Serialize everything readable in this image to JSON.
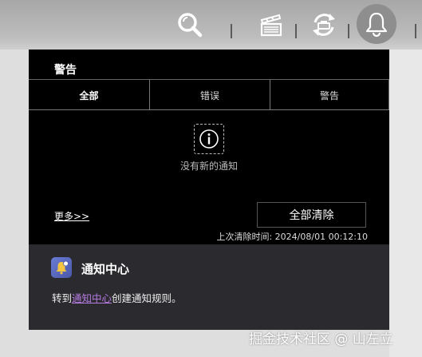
{
  "toolbar": {
    "icons": [
      "search-icon",
      "clapperboard-icon",
      "sync-icon",
      "bell-icon"
    ]
  },
  "popup": {
    "title": "警告",
    "tabs": [
      {
        "label": "全部",
        "active": true
      },
      {
        "label": "错误",
        "active": false
      },
      {
        "label": "警告",
        "active": false
      }
    ],
    "empty_message": "没有新的通知",
    "more_link": "更多>>",
    "clear_all_button": "全部清除",
    "last_cleared": "上次清除时间: 2024/08/01 00:12:10"
  },
  "notification_center": {
    "title": "通知中心",
    "text_prefix": "转到",
    "link_text": "通知中心",
    "text_suffix": "创建通知规则。"
  },
  "watermark": "掘金技术社区 @ 山左立",
  "colors": {
    "accent_link": "#b57be0",
    "popup_bg": "#000000",
    "section_bg": "#2a2a2f"
  }
}
